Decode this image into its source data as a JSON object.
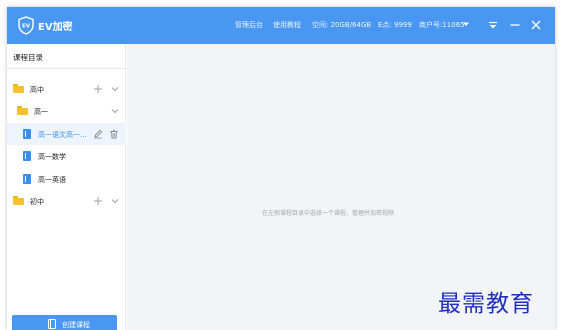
{
  "app": {
    "title": "EV加密",
    "logo_text": "EV"
  },
  "topbar": {
    "admin_label": "管理后台",
    "tutorial_label": "使用教程",
    "space_label": "空间: 20GB/64GB",
    "coins_label": "E点: 9999",
    "account_label": "商户号:11065"
  },
  "window_controls": [
    "menu-icon",
    "minimize-icon",
    "close-icon"
  ],
  "sidebar": {
    "title": "课程目录",
    "tree": {
      "gaozhong": "高中",
      "gaoyi": "高一",
      "courses": [
        "高一语文高一...",
        "高一数学",
        "高一英语"
      ],
      "chuzhong": "初中"
    },
    "create_button_label": "创建课程"
  },
  "main": {
    "empty_hint": "在左侧课程目录中选择一个课程，管理并加密视频"
  },
  "watermark": {
    "text": "最需教育"
  },
  "colors": {
    "accent": "#4a97f3",
    "folder": "#f9c12a",
    "course_icon": "#3a8ef0",
    "selected_bg": "#edf4fe",
    "main_bg": "#f3f4f6",
    "watermark": "#1f2fc0"
  }
}
